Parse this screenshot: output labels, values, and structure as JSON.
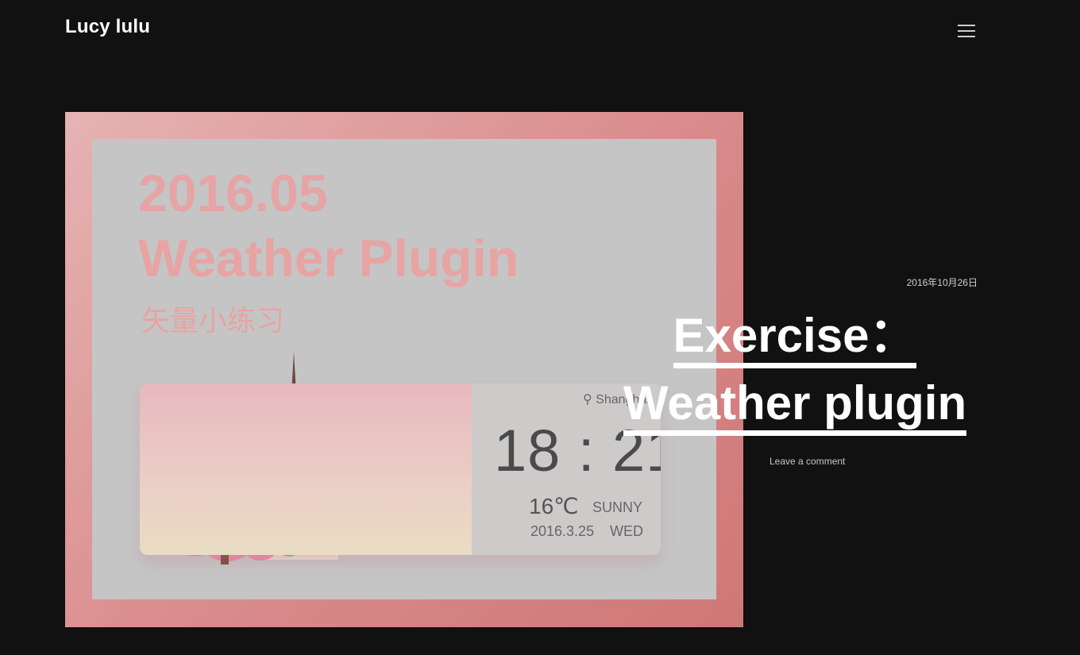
{
  "header": {
    "site_title": "Lucy lulu",
    "menu_icon": "hamburger-menu-icon"
  },
  "featured_image": {
    "year": "2016.05",
    "name": "Weather Plugin",
    "subtitle_cn": "矢量小练习",
    "widget": {
      "location": "Shanghai",
      "location_icon": "map-pin-icon",
      "time": "18 : 21",
      "temperature": "16℃",
      "condition": "SUNNY",
      "date": "2016.3.25",
      "weekday": "WED"
    },
    "colors": {
      "frame": "#d98a8a",
      "text": "#e8a3a3"
    }
  },
  "post": {
    "date": "2016年10月26日",
    "title_line1": "Exercise：",
    "title_line2": "Weather plugin",
    "comment_link": "Leave a comment"
  },
  "colors": {
    "background": "#111111",
    "text": "#ffffff"
  }
}
